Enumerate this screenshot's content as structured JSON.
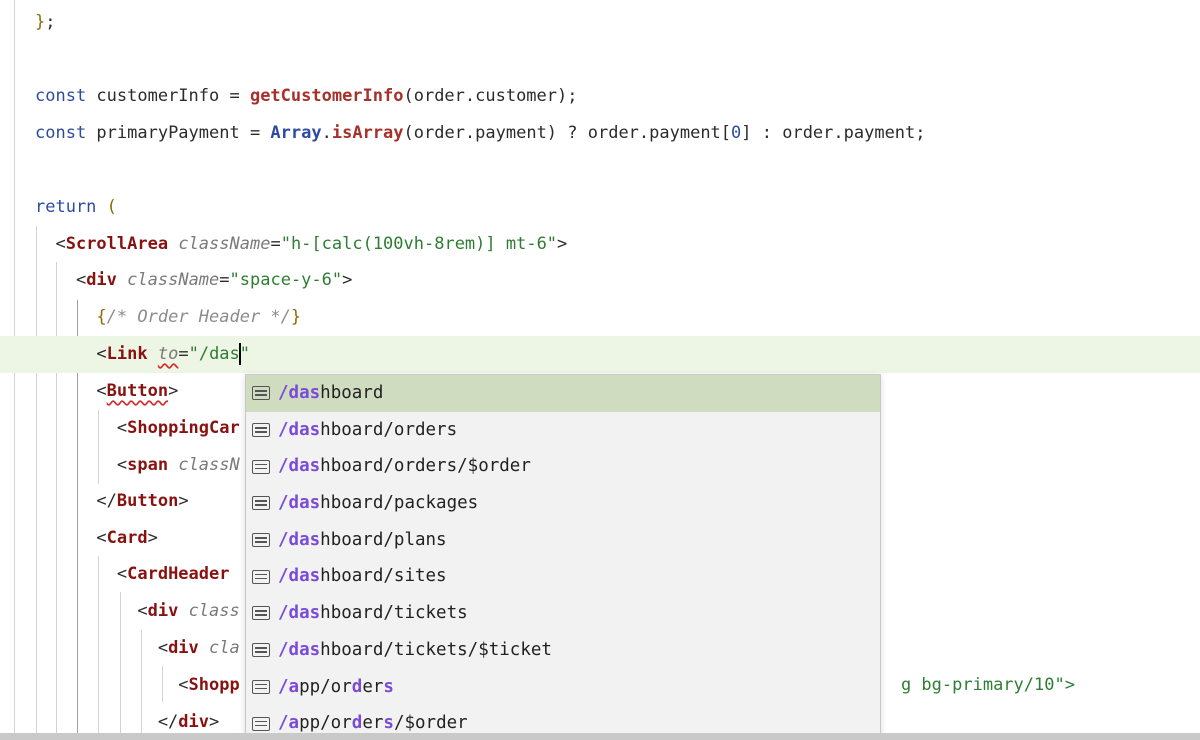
{
  "editor": {
    "lines": [
      {
        "id": "l1",
        "parts": [
          [
            "brace",
            "}"
          ],
          [
            "punct",
            ";"
          ]
        ]
      },
      {
        "id": "l2",
        "parts": []
      },
      {
        "id": "l3",
        "parts": [
          [
            "kw",
            "const"
          ],
          [
            "punct",
            " customerInfo = "
          ],
          [
            "fn",
            "getCustomerInfo"
          ],
          [
            "punct",
            "(order.customer);"
          ]
        ]
      },
      {
        "id": "l4",
        "parts": [
          [
            "kw",
            "const"
          ],
          [
            "punct",
            " primaryPayment = "
          ],
          [
            "obj",
            "Array"
          ],
          [
            "punct",
            "."
          ],
          [
            "fn",
            "isArray"
          ],
          [
            "punct",
            "(order.payment) ? order.payment["
          ],
          [
            "kw",
            "0"
          ],
          [
            "punct",
            "] : order.payment;"
          ]
        ]
      },
      {
        "id": "l5",
        "parts": []
      },
      {
        "id": "l6",
        "parts": [
          [
            "kw",
            "return"
          ],
          [
            "punct",
            " "
          ],
          [
            "brace",
            "("
          ]
        ]
      },
      {
        "id": "l7",
        "parts": [
          [
            "punct",
            "  <"
          ],
          [
            "tag",
            "ScrollArea"
          ],
          [
            "punct",
            " "
          ],
          [
            "attr",
            "className"
          ],
          [
            "punct",
            "="
          ],
          [
            "str",
            "\"h-[calc(100vh-8rem)] mt-6\""
          ],
          [
            "punct",
            ">"
          ]
        ]
      },
      {
        "id": "l8",
        "parts": [
          [
            "punct",
            "    <"
          ],
          [
            "tag",
            "div"
          ],
          [
            "punct",
            " "
          ],
          [
            "attr",
            "className"
          ],
          [
            "punct",
            "="
          ],
          [
            "str",
            "\"space-y-6\""
          ],
          [
            "punct",
            ">"
          ]
        ]
      },
      {
        "id": "l9",
        "parts": [
          [
            "punct",
            "      "
          ],
          [
            "brace",
            "{"
          ],
          [
            "cmt",
            "/* Order Header */"
          ],
          [
            "brace",
            "}"
          ]
        ]
      },
      {
        "id": "l10",
        "parts": [
          [
            "punct",
            "      <"
          ],
          [
            "tag",
            "Link"
          ],
          [
            "punct",
            " "
          ],
          [
            "attr",
            "to"
          ],
          [
            "punct",
            "="
          ],
          [
            "str",
            "\"/das"
          ],
          [
            "caret",
            ""
          ],
          [
            "str",
            "\""
          ]
        ]
      },
      {
        "id": "l11",
        "parts": [
          [
            "punct",
            "      <"
          ],
          [
            "tag",
            "Button"
          ],
          [
            "punct",
            ">"
          ]
        ]
      },
      {
        "id": "l12",
        "parts": [
          [
            "punct",
            "        <"
          ],
          [
            "tag",
            "ShoppingCar"
          ]
        ]
      },
      {
        "id": "l13",
        "parts": [
          [
            "punct",
            "        <"
          ],
          [
            "tag",
            "span"
          ],
          [
            "punct",
            " "
          ],
          [
            "attr",
            "classN"
          ]
        ]
      },
      {
        "id": "l14",
        "parts": [
          [
            "punct",
            "      </"
          ],
          [
            "tag",
            "Button"
          ],
          [
            "punct",
            ">"
          ]
        ]
      },
      {
        "id": "l15",
        "parts": [
          [
            "punct",
            "      <"
          ],
          [
            "tag",
            "Card"
          ],
          [
            "punct",
            ">"
          ]
        ]
      },
      {
        "id": "l16",
        "parts": [
          [
            "punct",
            "        <"
          ],
          [
            "tag",
            "CardHeader"
          ]
        ]
      },
      {
        "id": "l17",
        "parts": [
          [
            "punct",
            "          <"
          ],
          [
            "tag",
            "div"
          ],
          [
            "punct",
            " "
          ],
          [
            "attr",
            "class"
          ]
        ]
      },
      {
        "id": "l18",
        "parts": [
          [
            "punct",
            "            <"
          ],
          [
            "tag",
            "div"
          ],
          [
            "punct",
            " "
          ],
          [
            "attr",
            "cla"
          ]
        ]
      },
      {
        "id": "l19",
        "parts": [
          [
            "punct",
            "              <"
          ],
          [
            "tag",
            "Shopp"
          ]
        ]
      },
      {
        "id": "l20",
        "parts": [
          [
            "punct",
            "            </"
          ],
          [
            "tag",
            "div"
          ],
          [
            "punct",
            ">"
          ]
        ]
      }
    ],
    "tail_text": "g bg-primary/10\">"
  },
  "autocomplete": {
    "items": [
      {
        "match": "/das",
        "rest": "hboard",
        "selected": true
      },
      {
        "match": "/das",
        "rest": "hboard/orders",
        "selected": false
      },
      {
        "match": "/das",
        "rest": "hboard/orders/$order",
        "selected": false
      },
      {
        "match": "/das",
        "rest": "hboard/packages",
        "selected": false
      },
      {
        "match": "/das",
        "rest": "hboard/plans",
        "selected": false
      },
      {
        "match": "/das",
        "rest": "hboard/sites",
        "selected": false
      },
      {
        "match": "/das",
        "rest": "hboard/tickets",
        "selected": false
      },
      {
        "match": "/das",
        "rest": "hboard/tickets/$ticket",
        "selected": false
      },
      {
        "segments": [
          [
            "m",
            "/a"
          ],
          [
            "r",
            "pp/or"
          ],
          [
            "m",
            "d"
          ],
          [
            "r",
            "er"
          ],
          [
            "m",
            "s"
          ]
        ],
        "selected": false
      },
      {
        "segments": [
          [
            "m",
            "/a"
          ],
          [
            "r",
            "pp/or"
          ],
          [
            "m",
            "d"
          ],
          [
            "r",
            "er"
          ],
          [
            "m",
            "s"
          ],
          [
            "r",
            "/$order"
          ]
        ],
        "selected": false
      }
    ],
    "icon": "document-list-icon"
  }
}
